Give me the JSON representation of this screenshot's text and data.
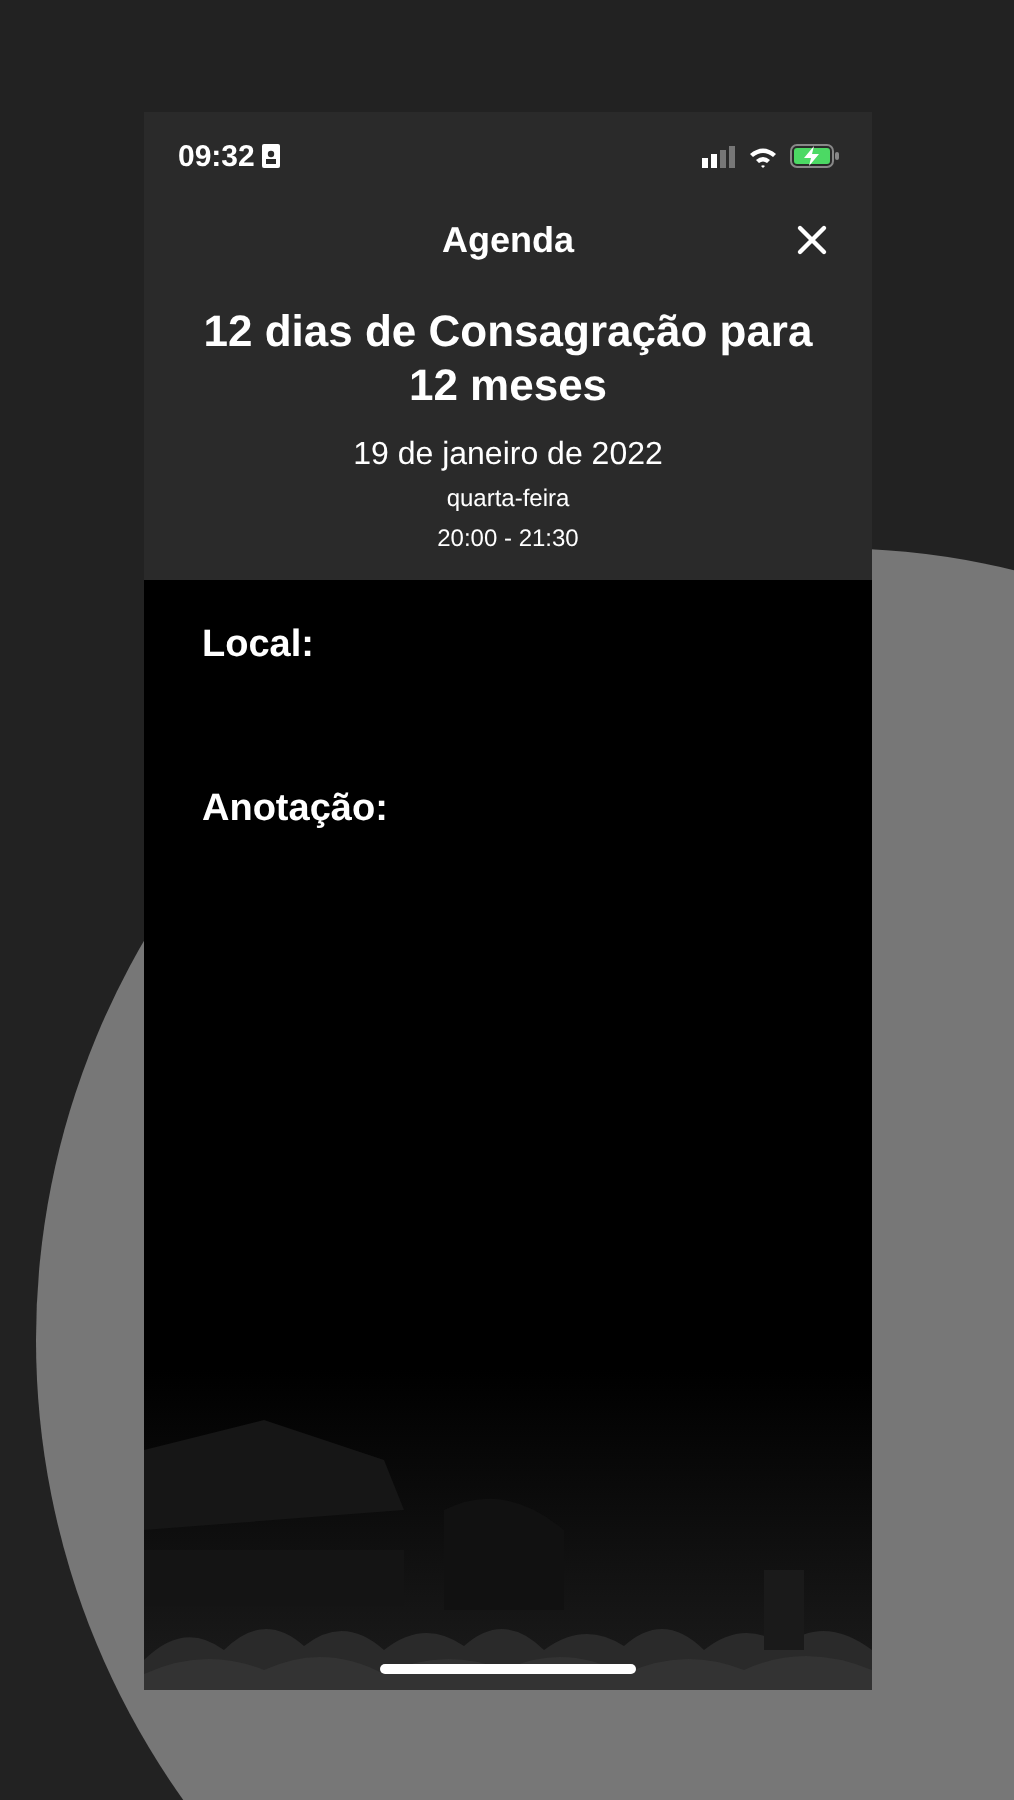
{
  "status_bar": {
    "time": "09:32"
  },
  "nav": {
    "title": "Agenda"
  },
  "event": {
    "title": "12 dias de Consagração para 12 meses",
    "date": "19 de janeiro de 2022",
    "weekday": "quarta-feira",
    "time_range": "20:00 - 21:30"
  },
  "fields": [
    {
      "label": "Local:"
    },
    {
      "label": "Anotação:"
    }
  ]
}
